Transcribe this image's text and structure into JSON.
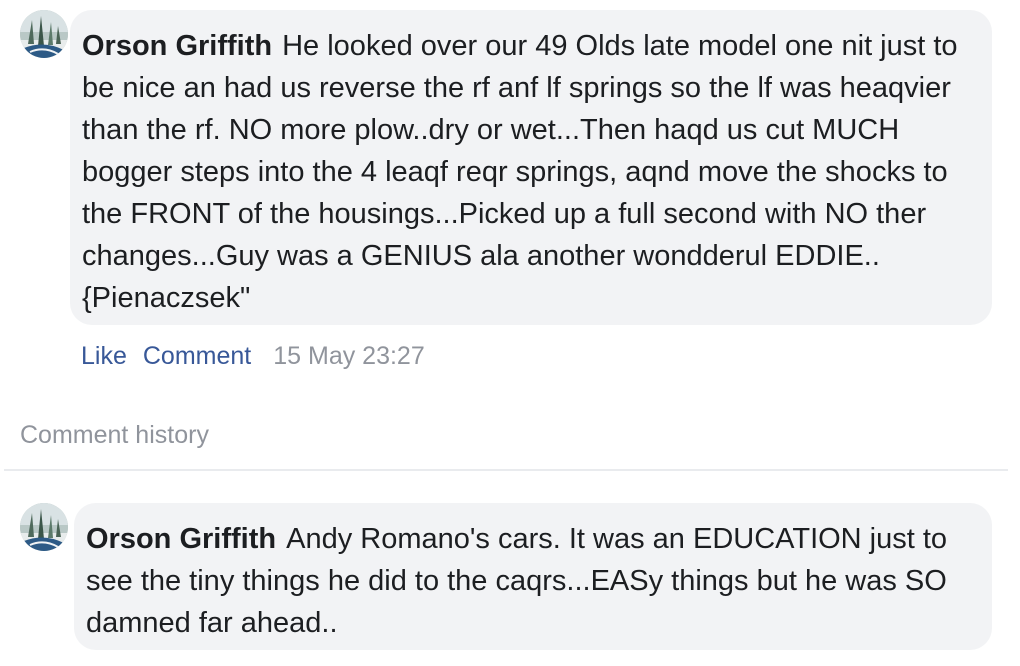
{
  "comments": [
    {
      "author": "Orson Griffith",
      "text": "He looked over our 49 Olds late model one nit just to be nice an had us reverse the rf anf lf springs so the lf was heaqvier than the rf. NO more plow..dry or wet...Then haqd us cut MUCH bogger steps into the 4 leaqf reqr springs, aqnd move the shocks to the FRONT of the housings...Picked up a full second with NO ther changes...Guy was a GENIUS ala another wondderul EDDIE..{Pienaczsek\"",
      "like_label": "Like",
      "comment_label": "Comment",
      "timestamp": "15 May 23:27"
    },
    {
      "author": "Orson Griffith",
      "text": "Andy Romano's cars. It was an EDUCATION just to see the tiny things he did to the caqrs...EASy things but he was SO damned far ahead.."
    }
  ],
  "comment_history_label": "Comment history",
  "colors": {
    "bubble": "#f2f3f5",
    "link": "#385898",
    "muted": "#90949c",
    "text": "#1c1e21",
    "divider": "#e9ebee"
  },
  "icons": {
    "avatar": "profile-photo-winter-trees"
  }
}
